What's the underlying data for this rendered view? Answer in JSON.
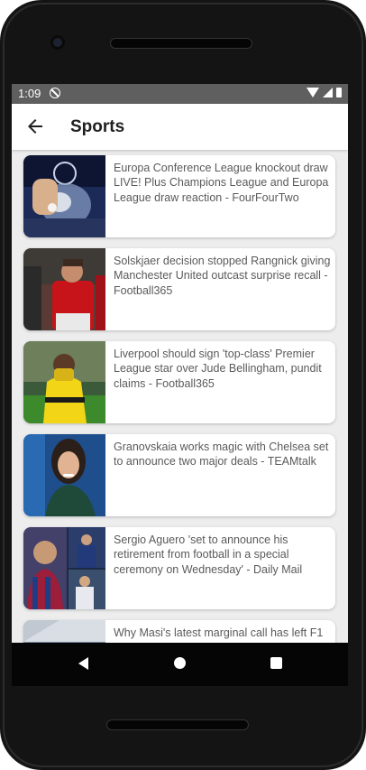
{
  "status": {
    "time": "1:09"
  },
  "header": {
    "title": "Sports"
  },
  "articles": [
    {
      "title": "Europa Conference League knockout draw LIVE! Plus Champions League and Europa League draw reaction - FourFourTwo"
    },
    {
      "title": "Solskjaer decision stopped Rangnick giving Manchester United outcast surprise recall - Football365"
    },
    {
      "title": "Liverpool should sign 'top-class' Premier League star over Jude Bellingham, pundit claims - Football365"
    },
    {
      "title": "Granovskaia works magic with Chelsea set to announce two major deals - TEAMtalk"
    },
    {
      "title": "Sergio Aguero 'set to announce his retirement from football in a special ceremony on Wednesday' - Daily Mail"
    },
    {
      "title": "Why Masi's latest marginal call has left F1"
    }
  ],
  "icons": {
    "back": "arrow-left-icon",
    "nav_back": "triangle-back-icon",
    "nav_home": "circle-home-icon",
    "nav_recent": "square-recents-icon"
  },
  "colors": {
    "status_bar": "#5f5f5f",
    "app_bar": "#ffffff",
    "list_bg": "#ededed",
    "card_text": "#5a5a5a"
  }
}
